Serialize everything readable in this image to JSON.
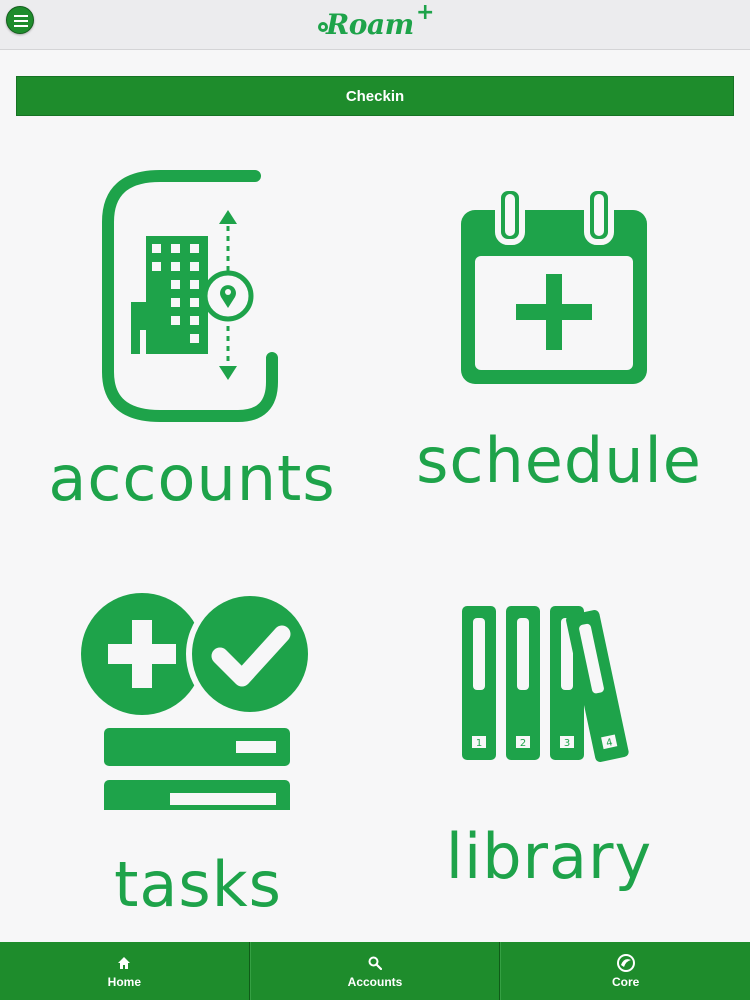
{
  "header": {
    "logo_text": "Roam",
    "logo_plus": "+"
  },
  "checkin": {
    "label": "Checkin"
  },
  "tiles": [
    {
      "label": "accounts",
      "icon": "building-location-icon"
    },
    {
      "label": "schedule",
      "icon": "calendar-add-icon"
    },
    {
      "label": "tasks",
      "icon": "tasks-icon"
    },
    {
      "label": "library",
      "icon": "binders-icon"
    }
  ],
  "library_binders": [
    "1",
    "2",
    "3",
    "4"
  ],
  "bottom_nav": [
    {
      "label": "Home",
      "icon": "home-icon"
    },
    {
      "label": "Accounts",
      "icon": "search-icon"
    },
    {
      "label": "Core",
      "icon": "core-icon"
    }
  ],
  "colors": {
    "brand_green": "#1e8c2c",
    "tile_green": "#1ea34a",
    "background": "#f7f7f8"
  }
}
